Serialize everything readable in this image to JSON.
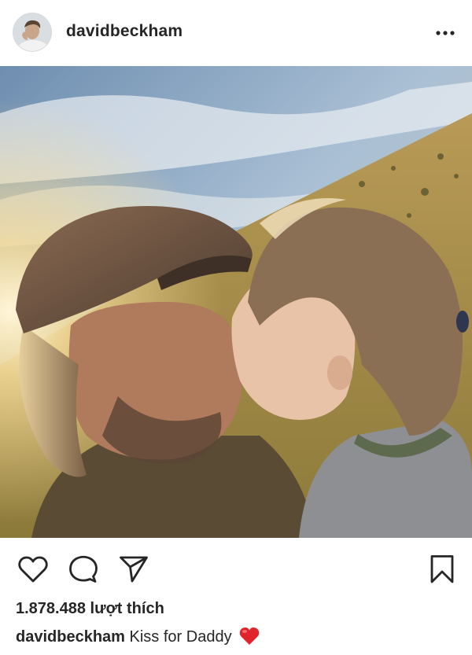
{
  "post": {
    "username": "davidbeckham",
    "more_icon": "more-horizontal-icon"
  },
  "actions": {
    "like_icon": "heart-icon",
    "comment_icon": "comment-icon",
    "share_icon": "send-icon",
    "save_icon": "bookmark-icon"
  },
  "likes": {
    "text": "1.878.488 lượt thích"
  },
  "caption": {
    "username": "davidbeckham",
    "text": "Kiss for Daddy",
    "emoji_icon": "red-heart-emoji-icon"
  },
  "colors": {
    "text": "#262626",
    "heart_red": "#e0242b"
  }
}
